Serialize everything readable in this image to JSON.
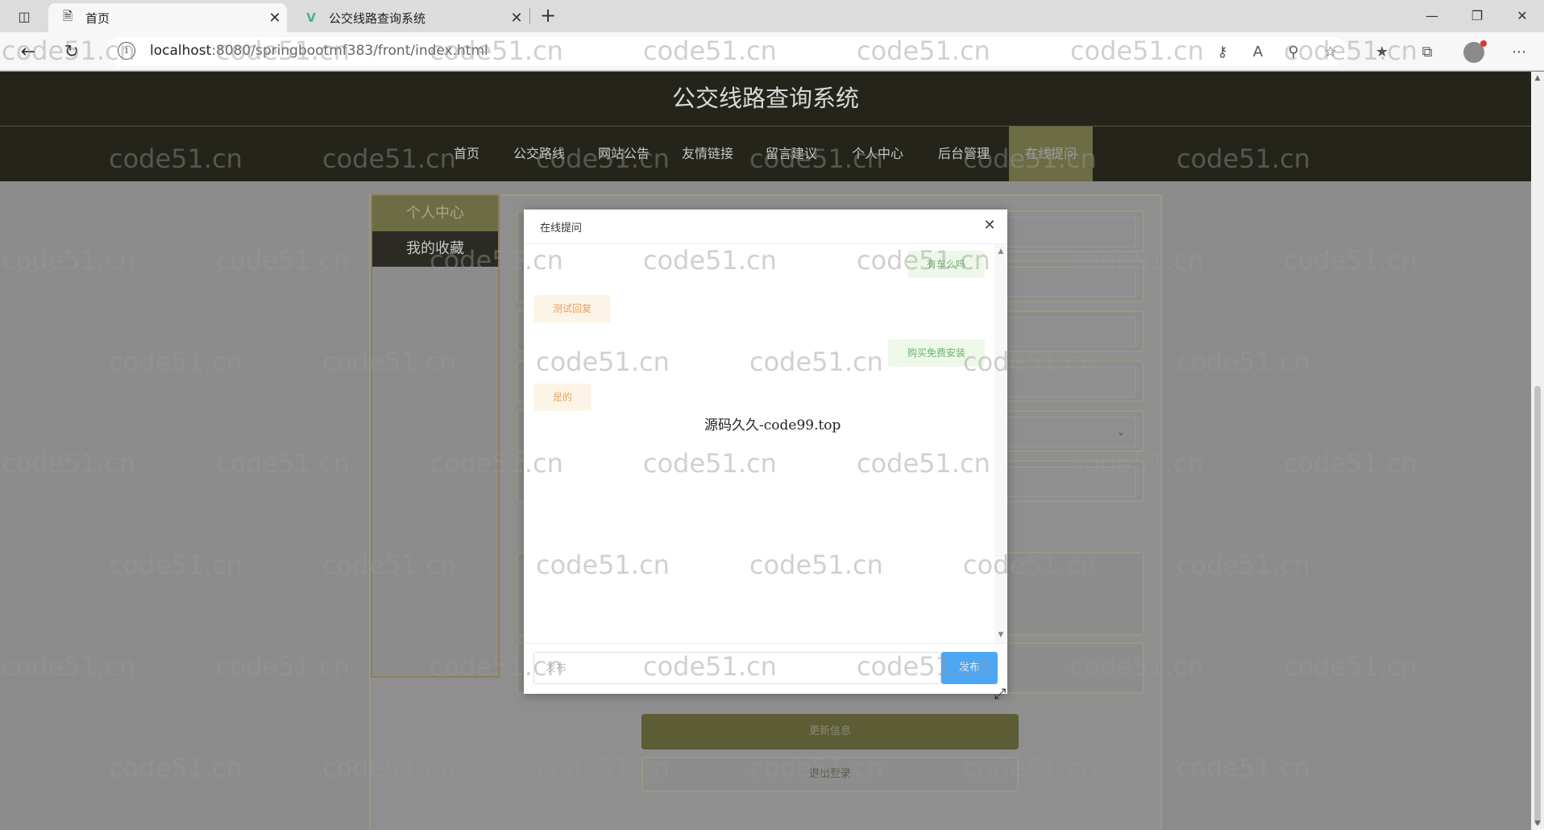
{
  "browser": {
    "tabs": [
      {
        "title": "首页",
        "active": true
      },
      {
        "title": "公交线路查询系统",
        "active": false
      }
    ],
    "url_host": "localhost",
    "url_path": ":8080/springbootmf383/front/index.html"
  },
  "site": {
    "title": "公交线路查询系统",
    "nav": [
      {
        "label": "首页"
      },
      {
        "label": "公交路线"
      },
      {
        "label": "网站公告"
      },
      {
        "label": "友情链接"
      },
      {
        "label": "留言建议"
      },
      {
        "label": "个人中心"
      },
      {
        "label": "后台管理"
      },
      {
        "label": "在线提问"
      }
    ],
    "active_nav": "在线提问"
  },
  "side_menu": {
    "items": [
      {
        "label": "个人中心"
      },
      {
        "label": "我的收藏"
      }
    ]
  },
  "profile_actions": {
    "update_label": "更新信息",
    "logout_label": "退出登录"
  },
  "dialog": {
    "title": "在线提问",
    "messages": [
      {
        "side": "right",
        "text": "有车么吗"
      },
      {
        "side": "left",
        "text": "测试回复"
      },
      {
        "side": "right",
        "text": "购买免费安装"
      },
      {
        "side": "left",
        "text": "是的"
      }
    ],
    "overlay_text": "源码久久-code99.top",
    "input_placeholder": "发布",
    "send_label": "发布"
  },
  "watermark": "code51.cn",
  "colors": {
    "header_bg": "#24241a",
    "nav_active_bg": "#6c6c45",
    "send_button": "#4da7f5",
    "bubble_right_text": "#6ab26a",
    "bubble_left_text": "#e2a45f"
  }
}
